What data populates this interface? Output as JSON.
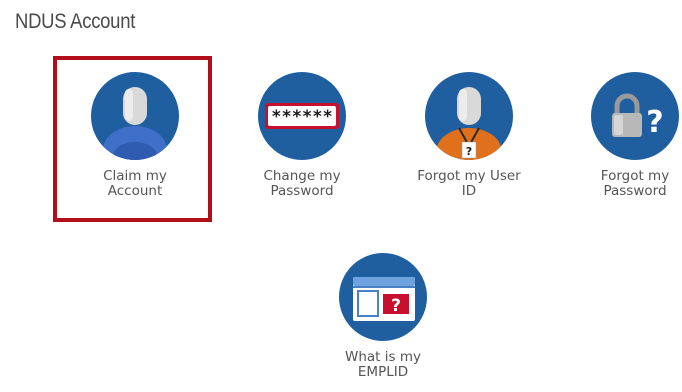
{
  "page": {
    "title": "NDUS Account"
  },
  "tiles": [
    {
      "id": "claim",
      "line1": "Claim my",
      "line2": "Account",
      "icon": "user-avatar-icon"
    },
    {
      "id": "change",
      "line1": "Change my",
      "line2": "Password",
      "icon": "password-field-icon",
      "mask": "******"
    },
    {
      "id": "forgot-id",
      "line1": "Forgot my User",
      "line2": "ID",
      "icon": "user-badge-icon",
      "badge": "?"
    },
    {
      "id": "forgot-pw",
      "line1": "Forgot my",
      "line2": "Password",
      "icon": "lock-question-icon",
      "mark": "?"
    },
    {
      "id": "emplid",
      "line1": "What is my",
      "line2": "EMPLID",
      "icon": "id-card-question-icon",
      "mark": "?"
    }
  ],
  "colors": {
    "circle": "#1f5fa0",
    "highlight_border": "#b30f1a",
    "avatar_body_blue": "#3f6fc8",
    "avatar_body_orange": "#e0701c",
    "question_red": "#c8102e"
  }
}
